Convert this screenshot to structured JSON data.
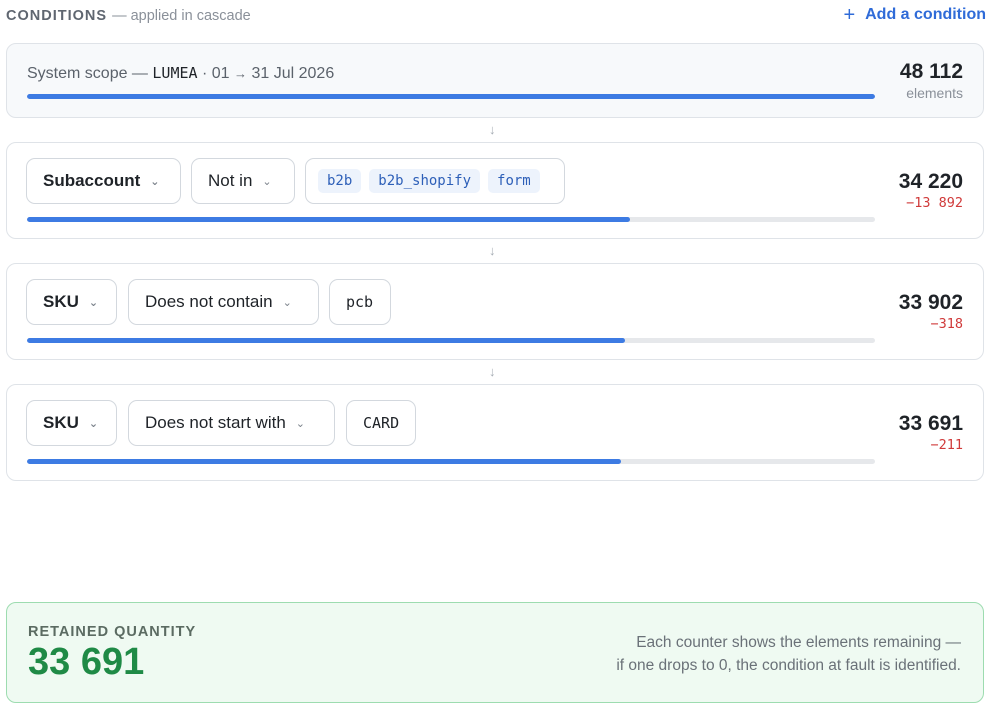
{
  "header": {
    "title": "CONDITIONS",
    "subtitle": "— applied in cascade",
    "add_icon": "+",
    "add_label": "Add a condition"
  },
  "scope": {
    "prefix": "System scope —",
    "account": "LUMEA",
    "dot": "·",
    "date_start": "01",
    "arrow": "→",
    "date_end": "31 Jul 2026",
    "count": "48 112",
    "unit": "elements",
    "progress": 1.0
  },
  "connector_icon": "↓",
  "conditions": [
    {
      "field": "Subaccount",
      "operator": "Not in",
      "values": [
        "b2b",
        "b2b_shopify",
        "form"
      ],
      "count": "34 220",
      "delta": "−13 892",
      "progress": 0.711
    },
    {
      "field": "SKU",
      "operator": "Does not contain",
      "value": "pcb",
      "count": "33 902",
      "delta": "−318",
      "progress": 0.705
    },
    {
      "field": "SKU",
      "operator": "Does not start with",
      "value": "CARD",
      "count": "33 691",
      "delta": "−211",
      "progress": 0.7
    }
  ],
  "chevron_icon": "⌄",
  "footer": {
    "label": "RETAINED QUANTITY",
    "value": "33 691",
    "note_line1": "Each counter shows the elements remaining —",
    "note_line2": "if one drops to 0, the condition at fault is identified."
  },
  "colors": {
    "accent": "#3d7be3",
    "link": "#2f6bd8",
    "negative": "#d03a3a",
    "success": "#1f8a46",
    "success_bg": "#effaf2"
  }
}
